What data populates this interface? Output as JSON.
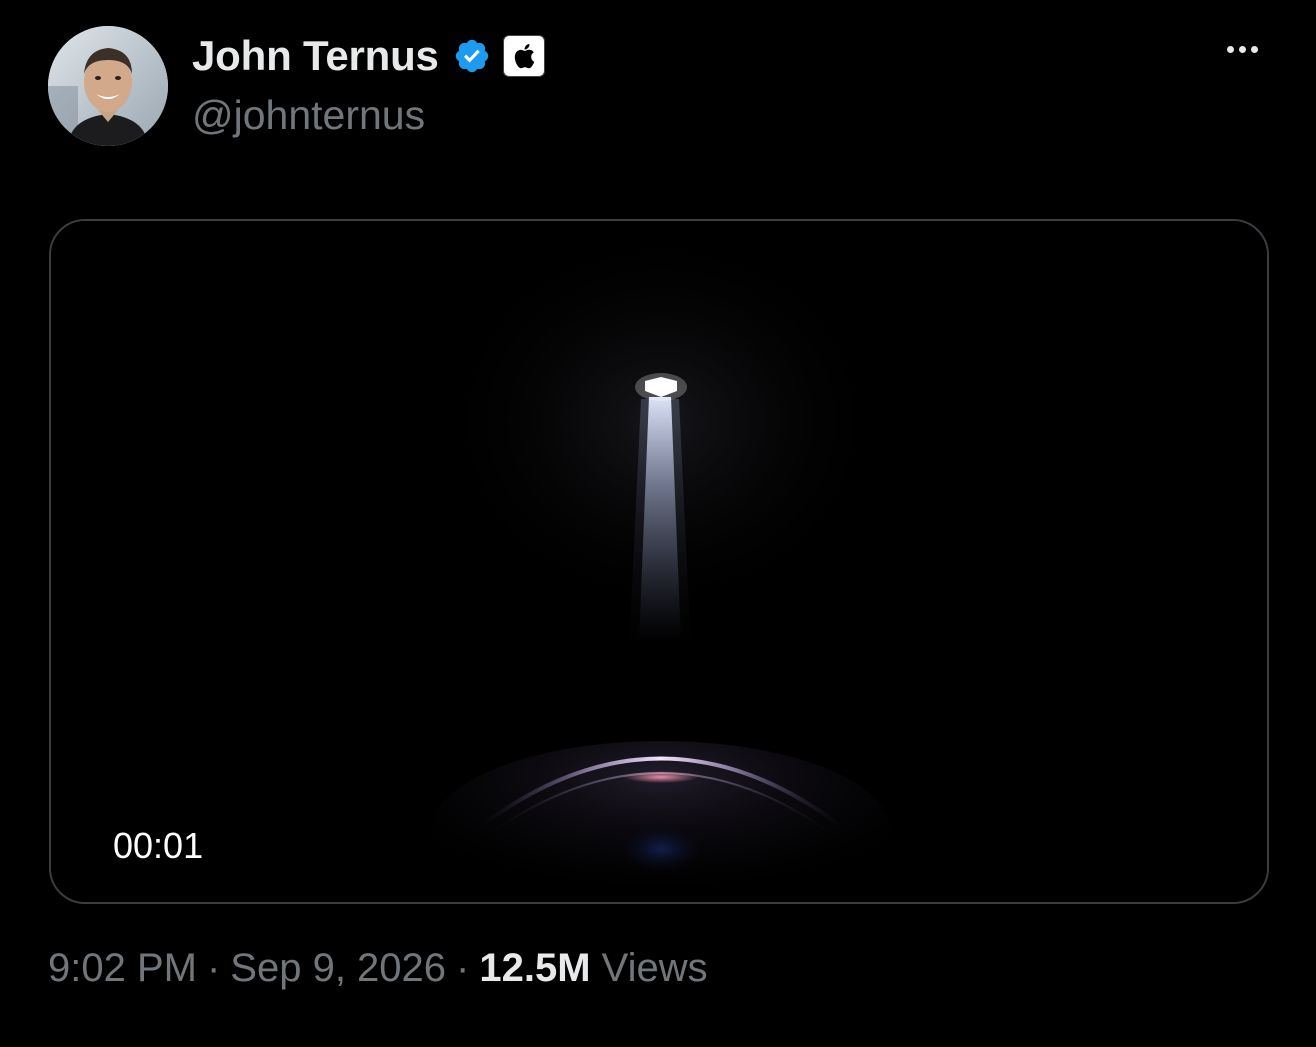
{
  "author": {
    "display_name": "John Ternus",
    "handle": "@johnternus",
    "verified_badge": "verified-check-icon",
    "affiliate_badge": "apple-logo-icon"
  },
  "more_options": "more-options-icon",
  "media": {
    "type": "video",
    "elapsed": "00:01"
  },
  "meta": {
    "time": "9:02 PM",
    "date": "Sep 9, 2026",
    "separator": "·",
    "views_count": "12.5M",
    "views_label": "Views"
  },
  "colors": {
    "background": "#000000",
    "primary_text": "#e7e9ea",
    "secondary_text": "#71767b",
    "verified_blue": "#1d9bf0",
    "media_border": "#3a3d41"
  }
}
